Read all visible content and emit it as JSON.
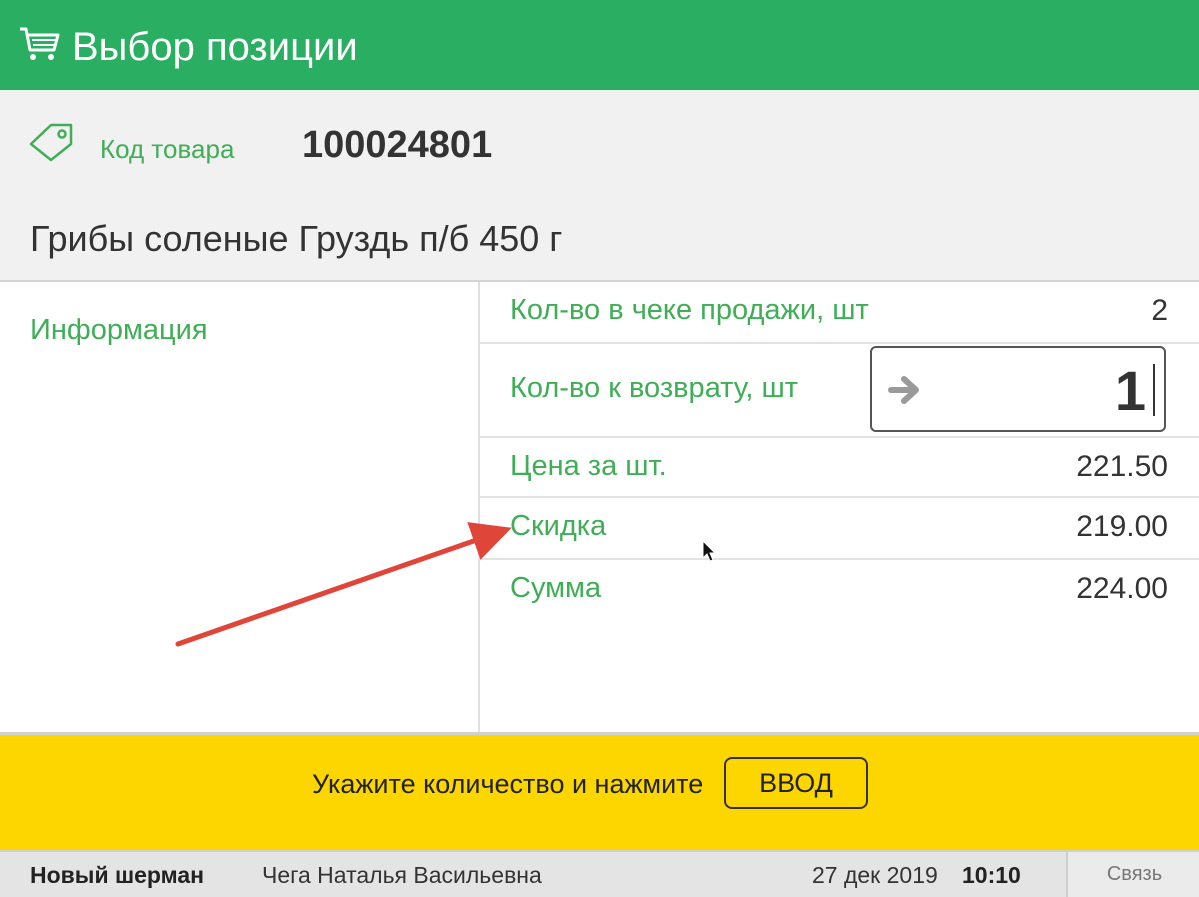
{
  "header": {
    "title": "Выбор позиции",
    "icon": "cart-icon",
    "color": "#2aaf62"
  },
  "product": {
    "code_label": "Код товара",
    "code": "100024801",
    "name": "Грибы соленые Груздь п/б 450 г"
  },
  "info": {
    "title": "Информация"
  },
  "details": [
    {
      "label": "Кол-во в чеке продажи, шт",
      "value": "2"
    },
    {
      "label": "Кол-во к возврату, шт",
      "value": "1"
    },
    {
      "label": "Цена за шт.",
      "value": "221.50"
    },
    {
      "label": "Скидка",
      "value": "219.00"
    },
    {
      "label": "Сумма",
      "value": "224.00"
    }
  ],
  "prompt": {
    "text": "Укажите количество и нажмите",
    "button": "ВВОД",
    "color": "#fdd600"
  },
  "status": {
    "store": "Новый шерман",
    "cashier": "Чега Наталья Васильевна",
    "date": "27 дек 2019",
    "time": "10:10",
    "link": "Связь"
  },
  "accent_color": "#3fae56",
  "annotation_color": "#e0453a"
}
